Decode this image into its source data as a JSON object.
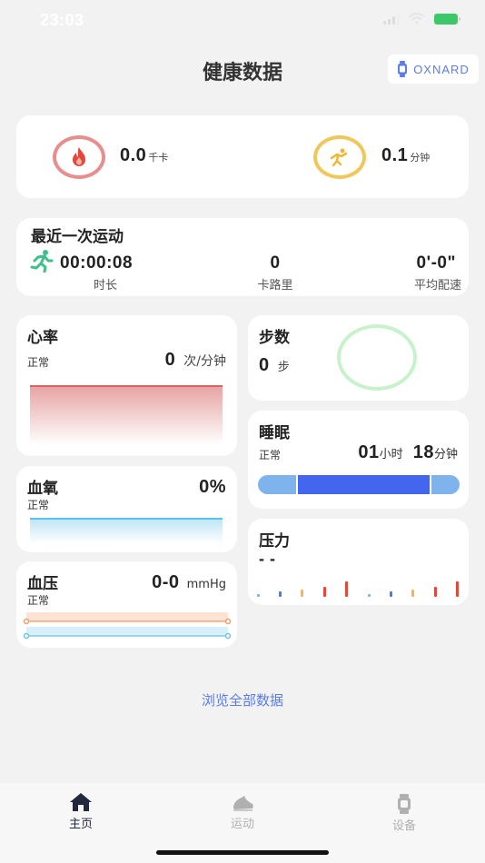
{
  "status": {
    "time": "23:03"
  },
  "header": {
    "title": "健康数据",
    "device_name": "OXNARD"
  },
  "summary": {
    "calories": {
      "value": "0.0",
      "unit": "千卡"
    },
    "activity": {
      "value": "0.1",
      "unit": "分钟"
    }
  },
  "last_workout": {
    "title": "最近一次运动",
    "duration_value": "00:00:08",
    "duration_label": "时长",
    "calories_value": "0",
    "calories_label": "卡路里",
    "pace_value": "0'-0\"",
    "pace_label": "平均配速"
  },
  "heart_rate": {
    "title": "心率",
    "status": "正常",
    "value": "0",
    "unit": "次/分钟"
  },
  "steps": {
    "title": "步数",
    "value": "0",
    "unit": "步"
  },
  "sleep": {
    "title": "睡眠",
    "status": "正常",
    "hours": "01",
    "hours_unit": "小时",
    "minutes": "18",
    "minutes_unit": "分钟"
  },
  "oxygen": {
    "title": "血氧",
    "status": "正常",
    "value": "0%"
  },
  "blood_pressure": {
    "title": "血压",
    "status": "正常",
    "value": "0-0",
    "unit": "mmHg"
  },
  "stress": {
    "title": "压力",
    "value": "- -"
  },
  "browse_all": "浏览全部数据",
  "tabs": [
    {
      "label": "主页",
      "icon": "home-icon",
      "active": true
    },
    {
      "label": "运动",
      "icon": "sneaker-icon",
      "active": false
    },
    {
      "label": "设备",
      "icon": "watch-icon",
      "active": false
    }
  ],
  "colors": {
    "accent": "#5b7de8",
    "calories_ring": "#e88e8e",
    "activity_ring": "#f0c75a",
    "runner": "#3dc08a",
    "sleep_deep": "#4466ee",
    "sleep_light": "#7fb3ee"
  }
}
